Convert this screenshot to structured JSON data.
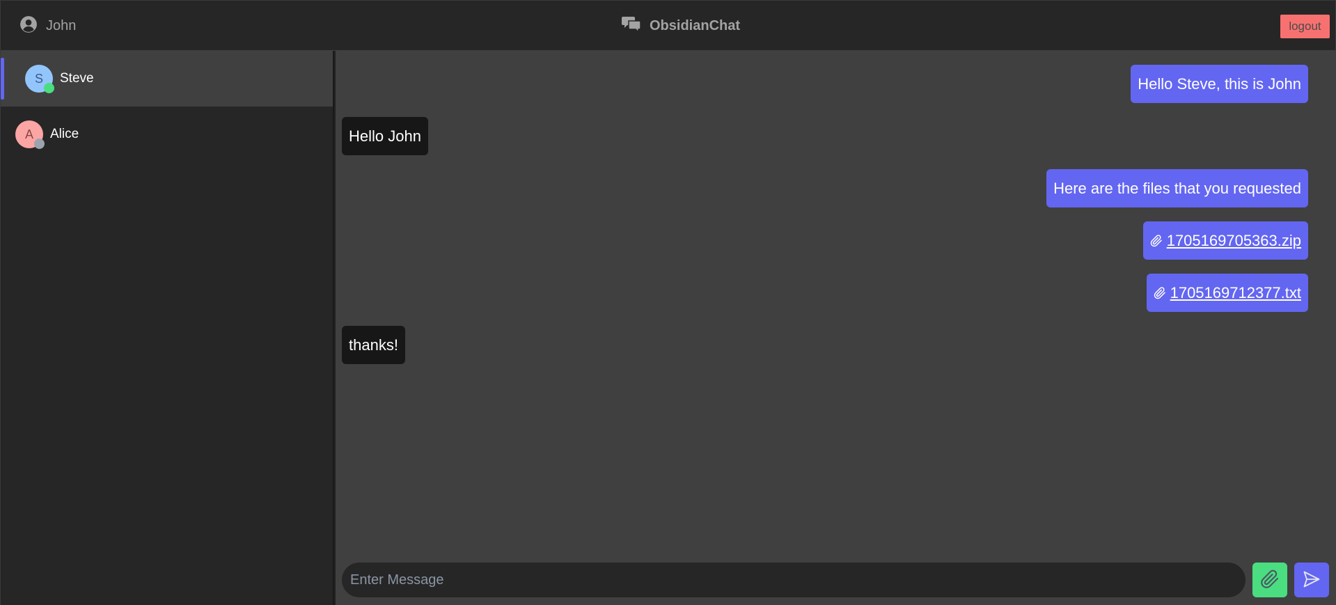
{
  "header": {
    "user_name": "John",
    "user_icon": "user-circle-icon",
    "brand_icon": "chat-bubbles-icon",
    "brand_name": "ObsidianChat",
    "logout_label": "logout"
  },
  "contacts": [
    {
      "initial": "S",
      "name": "Steve",
      "active": true,
      "status": "online",
      "avatar_color": "#93c5fd",
      "avatar_text_color": "#3b5b8a",
      "status_color": "#4ade80"
    },
    {
      "initial": "A",
      "name": "Alice",
      "active": false,
      "status": "offline",
      "avatar_color": "#fca5a5",
      "avatar_text_color": "#8a4545",
      "status_color": "#9ca3af"
    }
  ],
  "messages": [
    {
      "direction": "sent",
      "text": "Hello Steve, this is John"
    },
    {
      "direction": "received",
      "text": "Hello John"
    },
    {
      "direction": "sent",
      "text": "Here are the files that you requested"
    },
    {
      "direction": "sent",
      "type": "file",
      "filename": "1705169705363.zip"
    },
    {
      "direction": "sent",
      "type": "file",
      "filename": "1705169712377.txt"
    },
    {
      "direction": "received",
      "text": "thanks!"
    }
  ],
  "composer": {
    "placeholder": "Enter Message",
    "value": "",
    "attach_icon": "paperclip-icon",
    "send_icon": "send-icon"
  },
  "colors": {
    "accent": "#6366f1",
    "attach": "#4ade80",
    "logout": "#f87171",
    "received_bubble": "#171717"
  }
}
